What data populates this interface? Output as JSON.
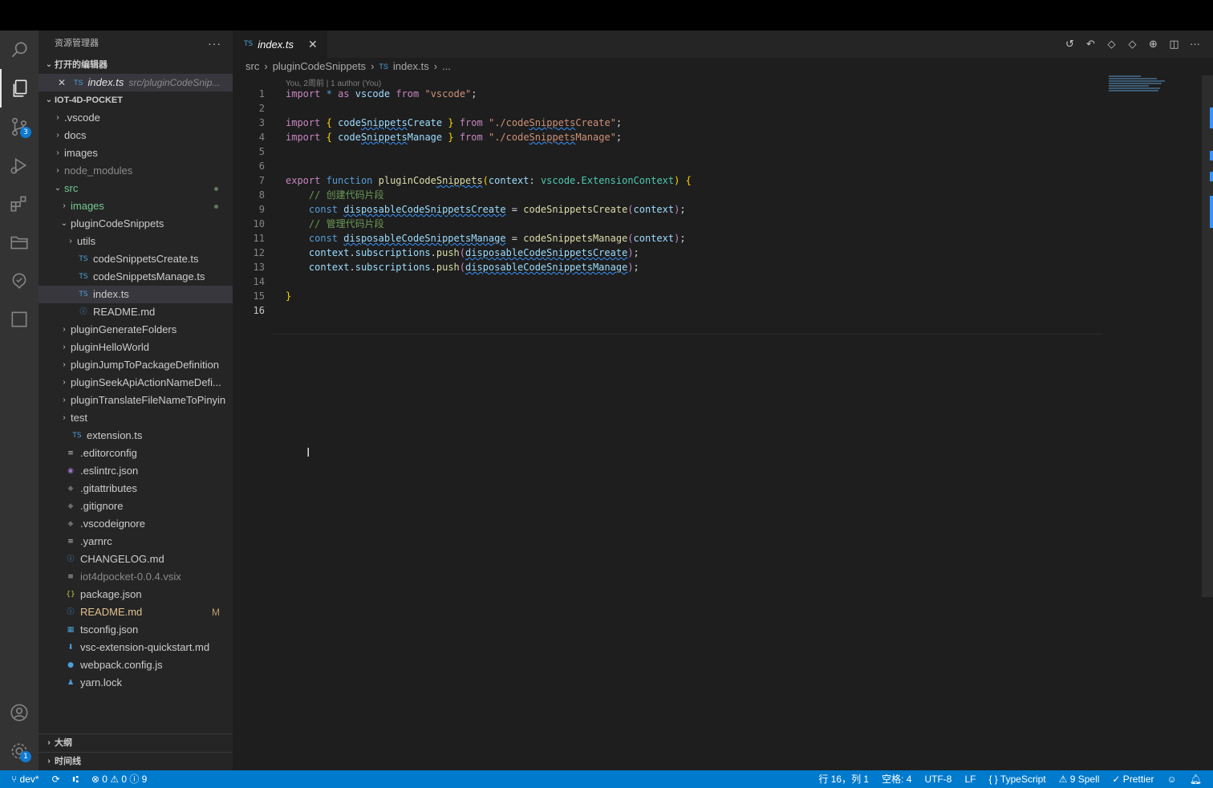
{
  "explorer": {
    "title": "资源管理器",
    "more": "···",
    "open_editors_label": "打开的编辑器",
    "open_editor": {
      "icon": "TS",
      "name": "index.ts",
      "path": "src/pluginCodeSnip..."
    },
    "project_label": "IOT-4D-POCKET",
    "tree": [
      {
        "indent": 1,
        "chev": "›",
        "icon": "",
        "name": ".vscode"
      },
      {
        "indent": 1,
        "chev": "›",
        "icon": "",
        "name": "docs"
      },
      {
        "indent": 1,
        "chev": "›",
        "icon": "",
        "name": "images"
      },
      {
        "indent": 1,
        "chev": "›",
        "icon": "",
        "name": "node_modules",
        "dim": true
      },
      {
        "indent": 1,
        "chev": "⌄",
        "icon": "",
        "name": "src",
        "dot": true,
        "color": "#73c991"
      },
      {
        "indent": 2,
        "chev": "›",
        "icon": "",
        "name": "images",
        "dot": true,
        "color": "#73c991"
      },
      {
        "indent": 2,
        "chev": "⌄",
        "icon": "",
        "name": "pluginCodeSnippets"
      },
      {
        "indent": 3,
        "chev": "›",
        "icon": "",
        "name": "utils"
      },
      {
        "indent": 3,
        "chev": "",
        "icon": "TS",
        "name": "codeSnippetsCreate.ts"
      },
      {
        "indent": 3,
        "chev": "",
        "icon": "TS",
        "name": "codeSnippetsManage.ts"
      },
      {
        "indent": 3,
        "chev": "",
        "icon": "TS",
        "name": "index.ts",
        "selected": true
      },
      {
        "indent": 3,
        "chev": "",
        "icon": "ⓘ",
        "name": "README.md"
      },
      {
        "indent": 2,
        "chev": "›",
        "icon": "",
        "name": "pluginGenerateFolders"
      },
      {
        "indent": 2,
        "chev": "›",
        "icon": "",
        "name": "pluginHelloWorld"
      },
      {
        "indent": 2,
        "chev": "›",
        "icon": "",
        "name": "pluginJumpToPackageDefinition"
      },
      {
        "indent": 2,
        "chev": "›",
        "icon": "",
        "name": "pluginSeekApiActionNameDefi..."
      },
      {
        "indent": 2,
        "chev": "›",
        "icon": "",
        "name": "pluginTranslateFileNameToPinyin"
      },
      {
        "indent": 2,
        "chev": "›",
        "icon": "",
        "name": "test"
      },
      {
        "indent": 2,
        "chev": "",
        "icon": "TS",
        "name": "extension.ts"
      },
      {
        "indent": 1,
        "chev": "",
        "icon": "≡",
        "name": ".editorconfig"
      },
      {
        "indent": 1,
        "chev": "",
        "icon": "◉",
        "name": ".eslintrc.json"
      },
      {
        "indent": 1,
        "chev": "",
        "icon": "◆",
        "name": ".gitattributes"
      },
      {
        "indent": 1,
        "chev": "",
        "icon": "◆",
        "name": ".gitignore"
      },
      {
        "indent": 1,
        "chev": "",
        "icon": "◆",
        "name": ".vscodeignore"
      },
      {
        "indent": 1,
        "chev": "",
        "icon": "≡",
        "name": ".yarnrc"
      },
      {
        "indent": 1,
        "chev": "",
        "icon": "ⓘ",
        "name": "CHANGELOG.md"
      },
      {
        "indent": 1,
        "chev": "",
        "icon": "≡",
        "name": "iot4dpocket-0.0.4.vsix",
        "dim": true
      },
      {
        "indent": 1,
        "chev": "",
        "icon": "{}",
        "name": "package.json"
      },
      {
        "indent": 1,
        "chev": "",
        "icon": "ⓘ",
        "name": "README.md",
        "modified": "M",
        "color": "#e2c08d"
      },
      {
        "indent": 1,
        "chev": "",
        "icon": "▦",
        "name": "tsconfig.json"
      },
      {
        "indent": 1,
        "chev": "",
        "icon": "⬇",
        "name": "vsc-extension-quickstart.md"
      },
      {
        "indent": 1,
        "chev": "",
        "icon": "●",
        "name": "webpack.config.js"
      },
      {
        "indent": 1,
        "chev": "",
        "icon": "♟",
        "name": "yarn.lock"
      }
    ],
    "outline_label": "大纲",
    "timeline_label": "时间线"
  },
  "activity": {
    "items": [
      "search-icon",
      "explorer-icon",
      "source-control-icon",
      "run-debug-icon",
      "extensions-icon",
      "folder-icon",
      "remote-icon",
      "square-icon"
    ],
    "scm_badge": "3",
    "settings_badge": "1"
  },
  "editor": {
    "tab": {
      "icon": "TS",
      "name": "index.ts",
      "close": "✕"
    },
    "breadcrumb": [
      "src",
      "pluginCodeSnippets",
      "index.ts",
      "..."
    ],
    "breadcrumb_ts": "TS",
    "blame": "You, 2周前 | 1 author (You)",
    "current_line": 16
  },
  "statusbar": {
    "branch": "dev*",
    "problems": "⊗ 0 ⚠ 0 ⓘ 9",
    "position": "行 16，列 1",
    "spaces": "空格: 4",
    "encoding": "UTF-8",
    "eol": "LF",
    "language": "{ } TypeScript",
    "spell": "⚠ 9 Spell",
    "prettier": "✓ Prettier"
  },
  "colors": {
    "accent": "#007acc",
    "activity": "#333333",
    "sidebar": "#252526",
    "editor": "#1e1e1e"
  }
}
